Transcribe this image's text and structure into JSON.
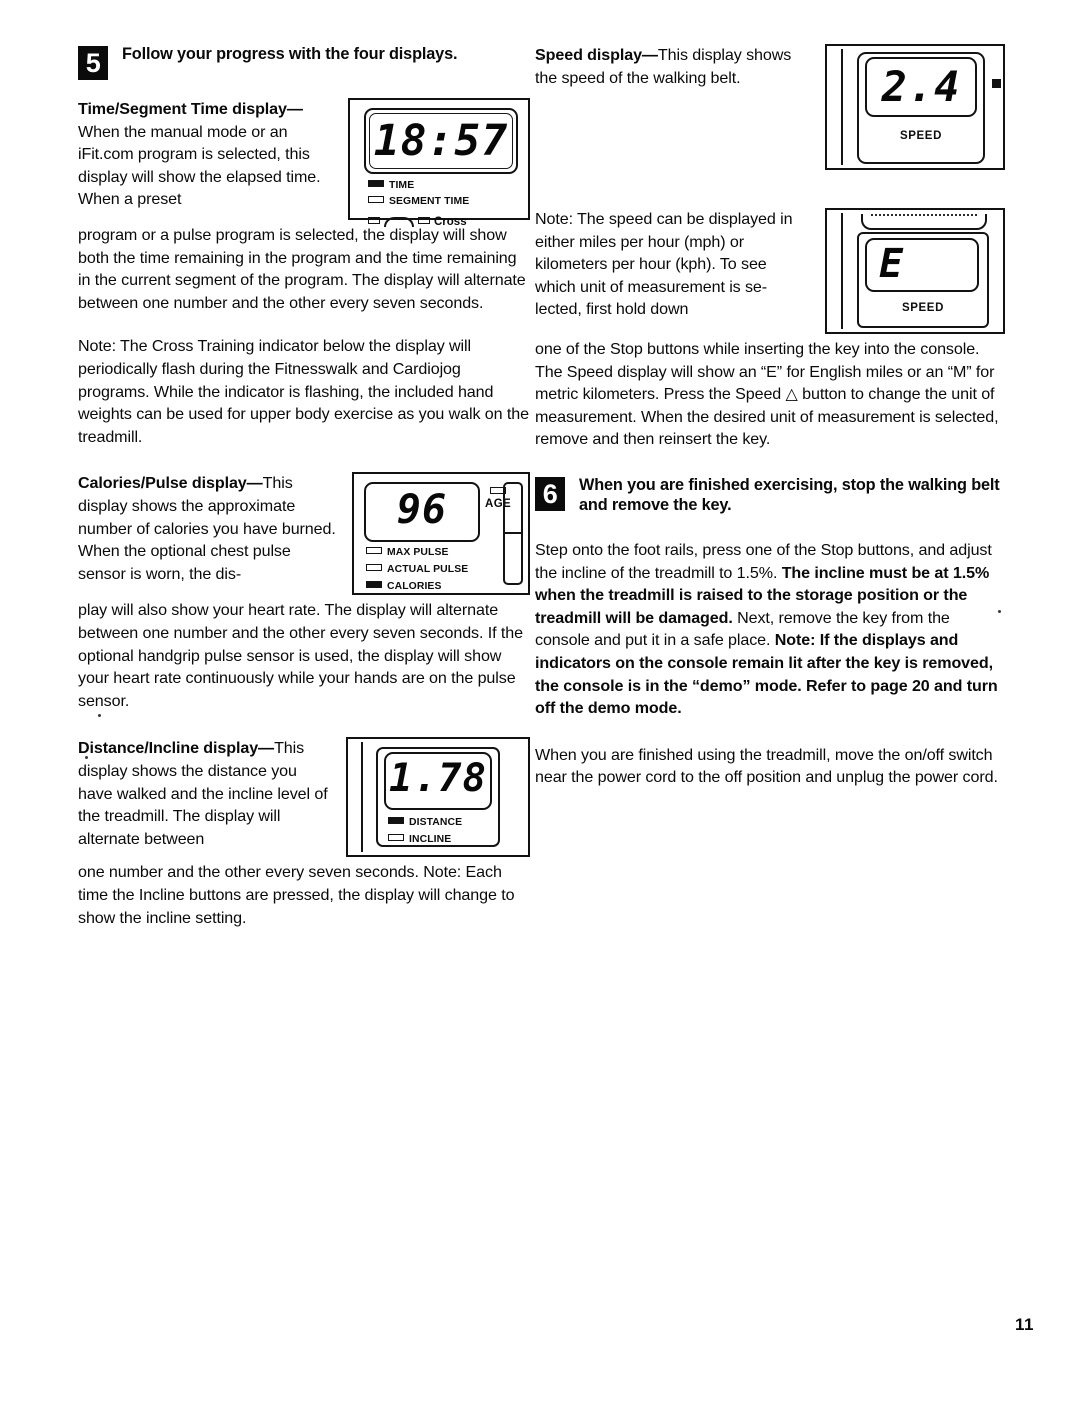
{
  "page": {
    "number": "11"
  },
  "steps": [
    {
      "badge": "5",
      "title": "Follow your progress with the four displays."
    },
    {
      "badge": "6",
      "title": "When you are finished exercising, stop the walking belt and remove the key."
    }
  ],
  "left_column": {
    "time_section": {
      "heading_bold": "Time/Segment Time display—",
      "intro": "When the manual mode or an iFit.com program is selected, this display will show the elapsed time. When a preset",
      "continuation": "program or a pulse program is selected, the display will show both the time remaining in the program and the time remaining in the current segment of the program. The display will alternate between one number and the other every seven seconds.",
      "note": "Note: The Cross Training indicator below the display will periodically flash during the Fitnesswalk and Cardiojog programs. While the indicator is flashing, the included hand weights can be used for upper body exercise as you walk on the treadmill."
    },
    "calories_section": {
      "heading_bold": "Calories/Pulse display—",
      "intro": "This display shows the approximate number of calories you have burned. When the optional chest pulse sensor is worn, the dis-",
      "continuation": "play will also show your heart rate. The display will alternate between one number and the other every seven seconds. If the optional handgrip pulse sensor is used, the display will show your heart rate continuously while your hands are on the pulse sensor."
    },
    "distance_section": {
      "heading_bold": "Distance/Incline display—",
      "intro": "This display shows the distance you have walked and the incline level of the treadmill. The display will alternate between",
      "continuation": "one number and the other every seven seconds. Note: Each time the Incline buttons are pressed, the display will change to show the incline setting."
    }
  },
  "right_column": {
    "speed_section": {
      "heading_bold": "Speed display—",
      "intro": "This display shows the speed of the walking belt."
    },
    "units_note": {
      "intro": "Note: The speed can be displayed in either miles per hour (mph) or kilometers per hour (kph). To see which unit of measurement is se-lected, first hold down",
      "continuation": "one of the Stop buttons while inserting the key into the console. The Speed display will show an “E” for English miles or an “M” for metric kilometers. Press the Speed △ button to change the unit of measurement. When the desired unit of measurement is selected, remove and then reinsert the key."
    },
    "step6_body": {
      "part1": "Step onto the foot rails, press one of the Stop buttons, and adjust the incline of the treadmill to 1.5%. ",
      "part2_bold": "The incline must be at 1.5% when the treadmill is raised to the storage position or the treadmill will be damaged.",
      "part3": " Next, remove the key from the console and put it in a safe place. ",
      "part4_bold": "Note: If the displays and indicators on the console remain lit after the key is removed, the console is in the “demo” mode. Refer to page 20 and turn off the demo mode."
    },
    "closing_paragraph": "When you are finished using the treadmill, move the on/off switch near the power cord to the off position and unplug the power cord."
  },
  "figures": {
    "time_display": {
      "digits": "18:57",
      "indicators": [
        {
          "label": "TIME",
          "state": "filled"
        },
        {
          "label": "SEGMENT TIME",
          "state": "empty"
        }
      ],
      "cross_label": "Cross"
    },
    "calories_display": {
      "digits": "96",
      "age_label": "AGE",
      "indicators": [
        {
          "label": "MAX PULSE",
          "state": "empty"
        },
        {
          "label": "ACTUAL PULSE",
          "state": "empty"
        },
        {
          "label": "CALORIES",
          "state": "filled"
        }
      ]
    },
    "distance_display": {
      "digits": "1.78",
      "indicators": [
        {
          "label": "DISTANCE",
          "state": "filled"
        },
        {
          "label": "INCLINE",
          "state": "empty"
        }
      ]
    },
    "speed_display": {
      "digits": "2.4",
      "label": "SPEED"
    },
    "speed_unit_display": {
      "digits": "E",
      "label": "SPEED"
    }
  }
}
